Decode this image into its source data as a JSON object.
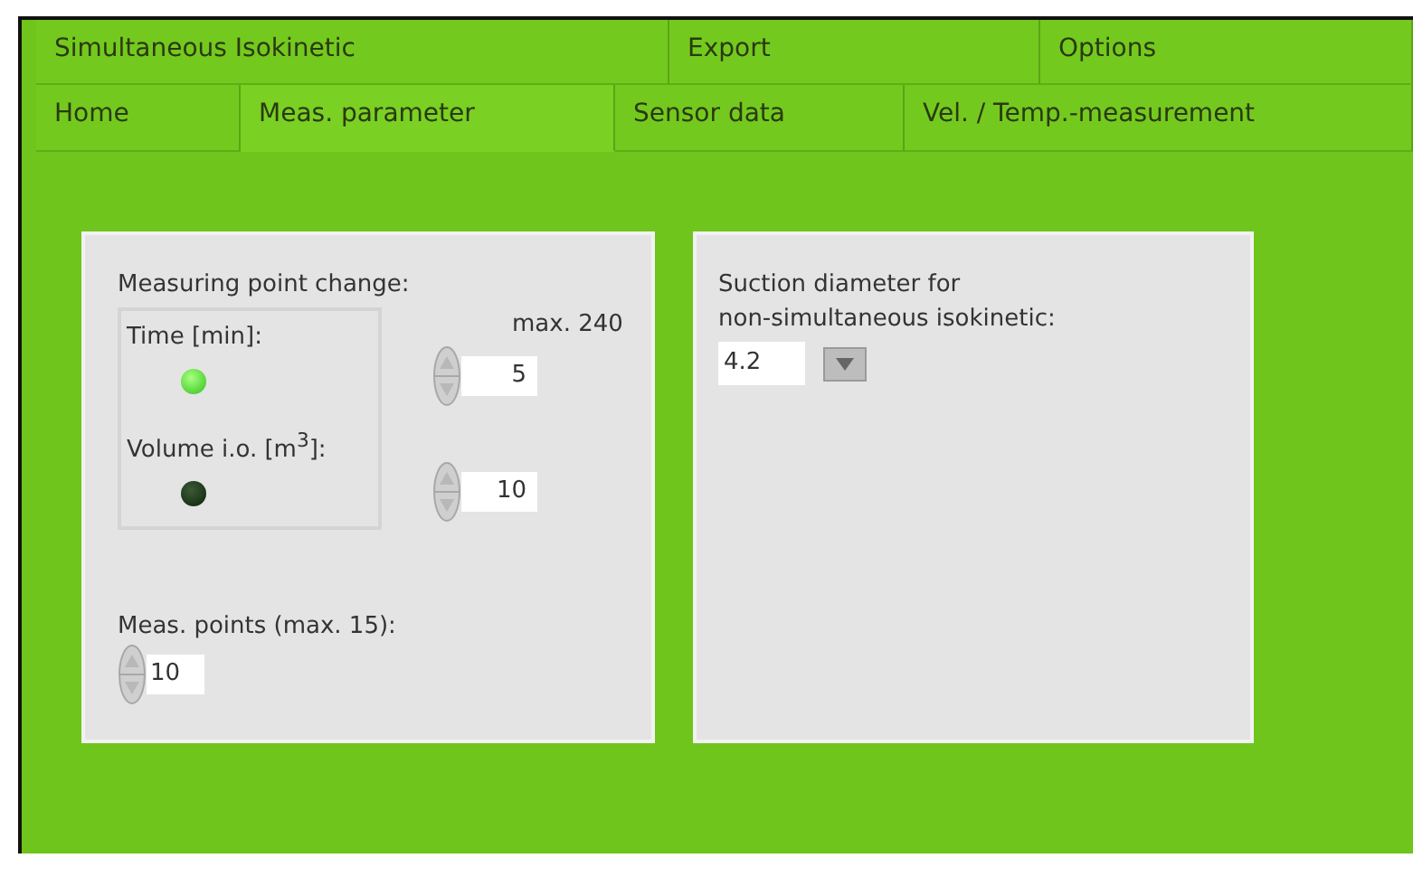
{
  "tab_rows": [
    [
      {
        "label": "Simultaneous Isokinetic",
        "selected": false
      },
      {
        "label": "Export",
        "selected": false
      },
      {
        "label": "Options",
        "selected": false
      }
    ],
    [
      {
        "label": "Home",
        "selected": false
      },
      {
        "label": "Meas. parameter",
        "selected": true
      },
      {
        "label": "Sensor data",
        "selected": false
      },
      {
        "label": "Vel. / Temp.-measurement",
        "selected": false
      }
    ]
  ],
  "measuring_panel": {
    "title": "Measuring point change:",
    "modes": [
      {
        "label": "Time [min]:",
        "on": true
      },
      {
        "label": "Volume i.o. [m$^{3}$]:",
        "on": false
      }
    ],
    "max_label": "max. 240",
    "spinners": [
      {
        "value": "5"
      },
      {
        "value": "10"
      }
    ],
    "points_label": "Meas. points (max. 15):",
    "points_value": "10"
  },
  "suction_panel": {
    "label_lines": [
      "Suction diameter for",
      "non-simultaneous isokinetic:"
    ],
    "value": "4.2"
  }
}
